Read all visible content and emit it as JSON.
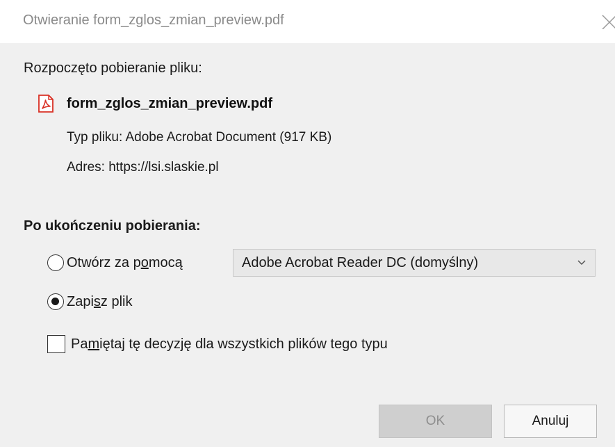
{
  "window": {
    "title": "Otwieranie form_zglos_zmian_preview.pdf",
    "close_icon": "close-icon"
  },
  "download": {
    "started_label": "Rozpoczęto pobieranie pliku:",
    "file_icon": "pdf-file-icon",
    "file_name": "form_zglos_zmian_preview.pdf",
    "type_label": "Typ pliku:",
    "type_value": "Adobe Acrobat Document (917 KB)",
    "address_label": "Adres:",
    "address_value": "https://lsi.slaskie.pl"
  },
  "after_download": {
    "heading": "Po ukończeniu pobierania:",
    "open_with": {
      "label_pre": "Otwórz za p",
      "label_accel": "o",
      "label_post": "mocą",
      "checked": false
    },
    "app_select": {
      "value": "Adobe Acrobat Reader DC  (domyślny)"
    },
    "save_file": {
      "label_pre": "Zapi",
      "label_accel": "s",
      "label_post": "z plik",
      "checked": true
    },
    "remember": {
      "label_pre": "Pa",
      "label_accel": "m",
      "label_post": "iętaj tę decyzję dla wszystkich plików tego typu",
      "checked": false
    }
  },
  "buttons": {
    "ok_label": "OK",
    "cancel_label": "Anuluj",
    "ok_disabled": true
  },
  "colors": {
    "pdf_icon_red": "#d93025",
    "dialog_bg": "#f0f0f0",
    "title_gray": "#8a8a8a"
  }
}
